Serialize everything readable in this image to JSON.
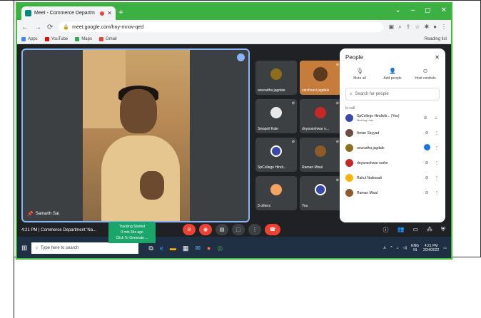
{
  "browser": {
    "tab_title": "Meet - Commerce Departm",
    "new_tab_glyph": "+",
    "url": "meet.google.com/hny-mrxw-qed",
    "bookmarks": [
      "Apps",
      "YouTube",
      "Maps",
      "Gmail"
    ],
    "reading_list": "Reading list",
    "window_controls": [
      "⌄",
      "–",
      "◻",
      "✕"
    ]
  },
  "meeting": {
    "main_speaker": "Samarth Sai",
    "time": "4:21 PM",
    "meeting_name": "Commerce Department 'Na...",
    "tracking": {
      "line1": "Tracking Started",
      "line2": "0 min 34s ago",
      "line3": "Click To Generate ..."
    }
  },
  "tiles": [
    {
      "name": "anuradha jagdale",
      "color": "#8d6e1a"
    },
    {
      "name": "vaishnavi jagdale",
      "color": "#d86a2f"
    },
    {
      "name": "Swapnil Kale",
      "color": "#e8e8e8"
    },
    {
      "name": "dnyaneshwar n...",
      "color": "#c62828"
    },
    {
      "name": "SpCollege Hindi...",
      "color": "#3949ab"
    },
    {
      "name": "Raman Misal",
      "color": "#8d5a2a"
    },
    {
      "name": "3 others",
      "color": "#f4a460"
    },
    {
      "name": "You",
      "color": "#3949ab"
    }
  ],
  "panel": {
    "title": "People",
    "close": "✕",
    "actions": [
      "Mute all",
      "Add people",
      "Host controls"
    ],
    "search_placeholder": "Search for people",
    "in_call": "In call",
    "people": [
      {
        "name": "SpCollege Hindivib...",
        "tag": "(You)",
        "sub": "Meeting host",
        "color": "#3949ab"
      },
      {
        "name": "Aman Sayyad",
        "tag": "",
        "sub": "",
        "color": "#6d4c41"
      },
      {
        "name": "anuradha jagdale",
        "tag": "",
        "sub": "",
        "color": "#8d6e1a"
      },
      {
        "name": "dnyaneshwar narke",
        "tag": "",
        "sub": "",
        "color": "#c62828"
      },
      {
        "name": "Rahul Naikwadi",
        "tag": "",
        "sub": "",
        "color": "#ffb300"
      },
      {
        "name": "Raman Misal",
        "tag": "",
        "sub": "",
        "color": "#8d5a2a"
      }
    ]
  },
  "taskbar": {
    "search_placeholder": "Type here to search",
    "lang": "ENG",
    "region": "IN",
    "time": "4:21 PM",
    "date": "2/24/2022"
  },
  "colors": {
    "accent_green": "#3cbf3c",
    "meet_bg": "#202124",
    "end_call": "#ea4335",
    "tile_bg": "#3c4043",
    "taskbar": "#1f3044"
  }
}
